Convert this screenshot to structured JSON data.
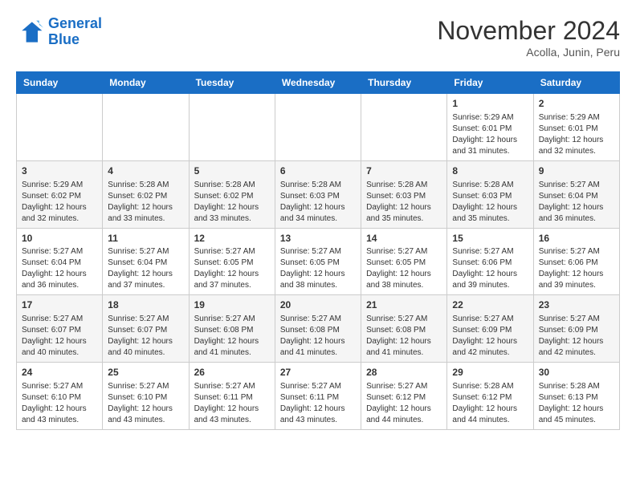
{
  "logo": {
    "line1": "General",
    "line2": "Blue"
  },
  "title": "November 2024",
  "location": "Acolla, Junin, Peru",
  "days_of_week": [
    "Sunday",
    "Monday",
    "Tuesday",
    "Wednesday",
    "Thursday",
    "Friday",
    "Saturday"
  ],
  "weeks": [
    [
      {
        "day": "",
        "info": ""
      },
      {
        "day": "",
        "info": ""
      },
      {
        "day": "",
        "info": ""
      },
      {
        "day": "",
        "info": ""
      },
      {
        "day": "",
        "info": ""
      },
      {
        "day": "1",
        "info": "Sunrise: 5:29 AM\nSunset: 6:01 PM\nDaylight: 12 hours and 31 minutes."
      },
      {
        "day": "2",
        "info": "Sunrise: 5:29 AM\nSunset: 6:01 PM\nDaylight: 12 hours and 32 minutes."
      }
    ],
    [
      {
        "day": "3",
        "info": "Sunrise: 5:29 AM\nSunset: 6:02 PM\nDaylight: 12 hours and 32 minutes."
      },
      {
        "day": "4",
        "info": "Sunrise: 5:28 AM\nSunset: 6:02 PM\nDaylight: 12 hours and 33 minutes."
      },
      {
        "day": "5",
        "info": "Sunrise: 5:28 AM\nSunset: 6:02 PM\nDaylight: 12 hours and 33 minutes."
      },
      {
        "day": "6",
        "info": "Sunrise: 5:28 AM\nSunset: 6:03 PM\nDaylight: 12 hours and 34 minutes."
      },
      {
        "day": "7",
        "info": "Sunrise: 5:28 AM\nSunset: 6:03 PM\nDaylight: 12 hours and 35 minutes."
      },
      {
        "day": "8",
        "info": "Sunrise: 5:28 AM\nSunset: 6:03 PM\nDaylight: 12 hours and 35 minutes."
      },
      {
        "day": "9",
        "info": "Sunrise: 5:27 AM\nSunset: 6:04 PM\nDaylight: 12 hours and 36 minutes."
      }
    ],
    [
      {
        "day": "10",
        "info": "Sunrise: 5:27 AM\nSunset: 6:04 PM\nDaylight: 12 hours and 36 minutes."
      },
      {
        "day": "11",
        "info": "Sunrise: 5:27 AM\nSunset: 6:04 PM\nDaylight: 12 hours and 37 minutes."
      },
      {
        "day": "12",
        "info": "Sunrise: 5:27 AM\nSunset: 6:05 PM\nDaylight: 12 hours and 37 minutes."
      },
      {
        "day": "13",
        "info": "Sunrise: 5:27 AM\nSunset: 6:05 PM\nDaylight: 12 hours and 38 minutes."
      },
      {
        "day": "14",
        "info": "Sunrise: 5:27 AM\nSunset: 6:05 PM\nDaylight: 12 hours and 38 minutes."
      },
      {
        "day": "15",
        "info": "Sunrise: 5:27 AM\nSunset: 6:06 PM\nDaylight: 12 hours and 39 minutes."
      },
      {
        "day": "16",
        "info": "Sunrise: 5:27 AM\nSunset: 6:06 PM\nDaylight: 12 hours and 39 minutes."
      }
    ],
    [
      {
        "day": "17",
        "info": "Sunrise: 5:27 AM\nSunset: 6:07 PM\nDaylight: 12 hours and 40 minutes."
      },
      {
        "day": "18",
        "info": "Sunrise: 5:27 AM\nSunset: 6:07 PM\nDaylight: 12 hours and 40 minutes."
      },
      {
        "day": "19",
        "info": "Sunrise: 5:27 AM\nSunset: 6:08 PM\nDaylight: 12 hours and 41 minutes."
      },
      {
        "day": "20",
        "info": "Sunrise: 5:27 AM\nSunset: 6:08 PM\nDaylight: 12 hours and 41 minutes."
      },
      {
        "day": "21",
        "info": "Sunrise: 5:27 AM\nSunset: 6:08 PM\nDaylight: 12 hours and 41 minutes."
      },
      {
        "day": "22",
        "info": "Sunrise: 5:27 AM\nSunset: 6:09 PM\nDaylight: 12 hours and 42 minutes."
      },
      {
        "day": "23",
        "info": "Sunrise: 5:27 AM\nSunset: 6:09 PM\nDaylight: 12 hours and 42 minutes."
      }
    ],
    [
      {
        "day": "24",
        "info": "Sunrise: 5:27 AM\nSunset: 6:10 PM\nDaylight: 12 hours and 43 minutes."
      },
      {
        "day": "25",
        "info": "Sunrise: 5:27 AM\nSunset: 6:10 PM\nDaylight: 12 hours and 43 minutes."
      },
      {
        "day": "26",
        "info": "Sunrise: 5:27 AM\nSunset: 6:11 PM\nDaylight: 12 hours and 43 minutes."
      },
      {
        "day": "27",
        "info": "Sunrise: 5:27 AM\nSunset: 6:11 PM\nDaylight: 12 hours and 43 minutes."
      },
      {
        "day": "28",
        "info": "Sunrise: 5:27 AM\nSunset: 6:12 PM\nDaylight: 12 hours and 44 minutes."
      },
      {
        "day": "29",
        "info": "Sunrise: 5:28 AM\nSunset: 6:12 PM\nDaylight: 12 hours and 44 minutes."
      },
      {
        "day": "30",
        "info": "Sunrise: 5:28 AM\nSunset: 6:13 PM\nDaylight: 12 hours and 45 minutes."
      }
    ]
  ]
}
